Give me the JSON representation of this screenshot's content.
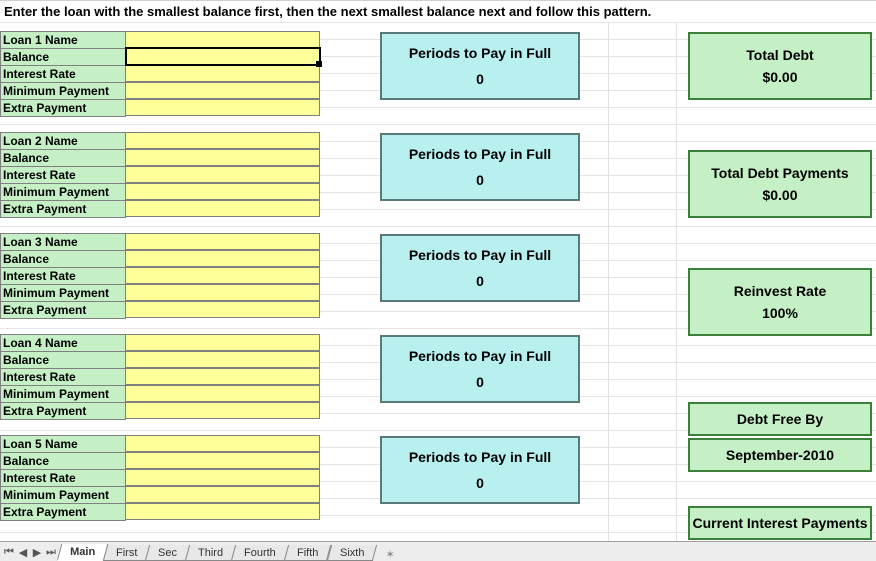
{
  "instruction": "Enter the loan with the smallest balance first, then the next smallest balance next and follow this pattern.",
  "loan_field_labels": [
    "Loan 1 Name",
    "Balance",
    "Interest Rate",
    "Minimum Payment",
    "Extra Payment"
  ],
  "loan_labels_prefix": "Loan",
  "loans": [
    {
      "name_label": "Loan 1 Name"
    },
    {
      "name_label": "Loan 2 Name"
    },
    {
      "name_label": "Loan 3 Name"
    },
    {
      "name_label": "Loan 4 Name"
    },
    {
      "name_label": "Loan 5 Name"
    }
  ],
  "field_labels": {
    "balance": "Balance",
    "interest_rate": "Interest Rate",
    "minimum_payment": "Minimum Payment",
    "extra_payment": "Extra Payment"
  },
  "periods": {
    "title": "Periods to Pay in Full",
    "values": [
      "0",
      "0",
      "0",
      "0",
      "0"
    ]
  },
  "summary": {
    "total_debt": {
      "label": "Total Debt",
      "value": "$0.00"
    },
    "total_debt_payments": {
      "label": "Total Debt Payments",
      "value": "$0.00"
    },
    "reinvest_rate": {
      "label": "Reinvest Rate",
      "value": "100%"
    },
    "debt_free_by": {
      "label": "Debt Free By",
      "value": "September-2010"
    },
    "current_interest_payments": {
      "label": "Current Interest Payments"
    }
  },
  "tabs": [
    "Main",
    "First",
    "Sec",
    "Third",
    "Fourth",
    "Fifth",
    "Sixth"
  ],
  "active_tab": "Main",
  "selected_cell": {
    "loan": 1,
    "field": "balance"
  }
}
